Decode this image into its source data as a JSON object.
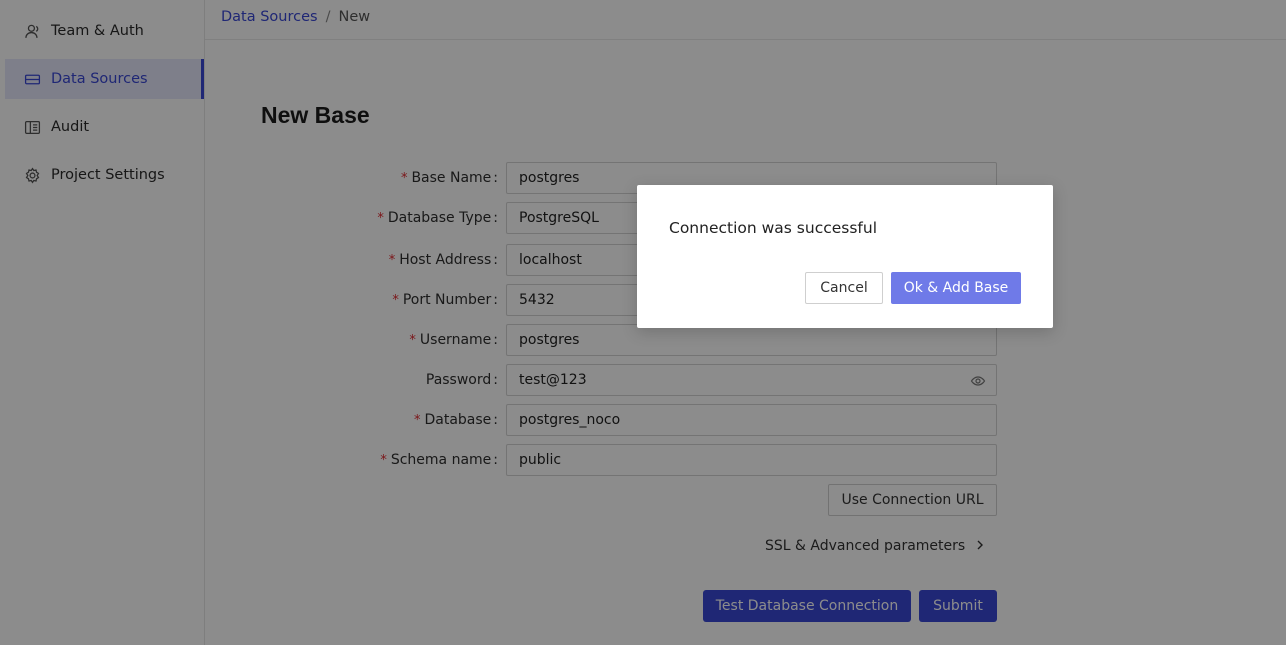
{
  "sidebar": {
    "items": [
      {
        "label": "Team & Auth",
        "icon": "users-icon"
      },
      {
        "label": "Data Sources",
        "icon": "database-icon",
        "active": true
      },
      {
        "label": "Audit",
        "icon": "book-icon"
      },
      {
        "label": "Project Settings",
        "icon": "gear-icon"
      }
    ]
  },
  "breadcrumb": {
    "link": "Data Sources",
    "separator": "/",
    "current": "New"
  },
  "page": {
    "title": "New Base"
  },
  "form": {
    "base_name": {
      "label": "Base Name",
      "value": "postgres",
      "required": true
    },
    "database_type": {
      "label": "Database Type",
      "value": "PostgreSQL",
      "required": true
    },
    "host_address": {
      "label": "Host Address",
      "value": "localhost",
      "required": true
    },
    "port_number": {
      "label": "Port Number",
      "value": "5432",
      "required": true
    },
    "username": {
      "label": "Username",
      "value": "postgres",
      "required": true
    },
    "password": {
      "label": "Password",
      "value": "test@123",
      "required": false
    },
    "database": {
      "label": "Database",
      "value": "postgres_noco",
      "required": true
    },
    "schema_name": {
      "label": "Schema name",
      "value": "public",
      "required": true
    },
    "required_marker": "*",
    "colon": ":"
  },
  "buttons": {
    "use_connection_url": "Use Connection URL",
    "ssl_advanced": "SSL & Advanced parameters",
    "test_connection": "Test Database Connection",
    "submit": "Submit"
  },
  "modal": {
    "message": "Connection was successful",
    "cancel": "Cancel",
    "ok": "Ok & Add Base"
  },
  "colors": {
    "accent": "#3a47d5",
    "modal_primary": "#6f7ae8",
    "required": "#e0282e"
  }
}
